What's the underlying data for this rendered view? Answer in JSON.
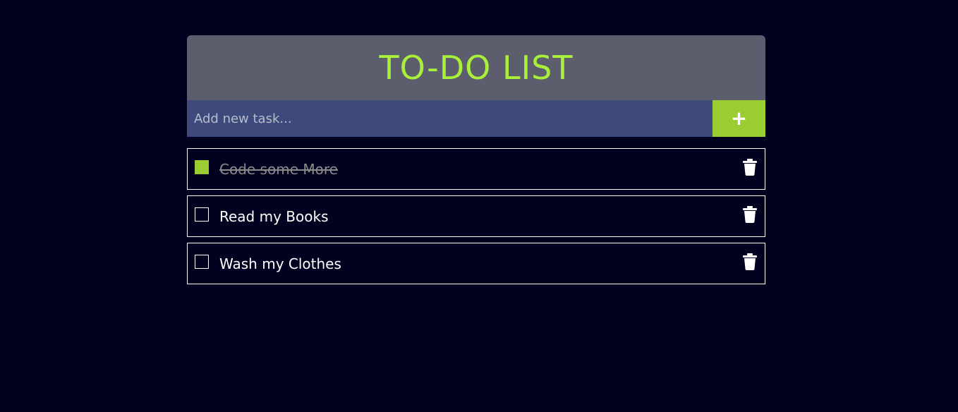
{
  "app": {
    "title": "TO-DO LIST"
  },
  "input": {
    "placeholder": "Add new task...",
    "value": "",
    "add_label": "+"
  },
  "tasks": [
    {
      "text": "Code some More",
      "done": true
    },
    {
      "text": "Read my Books",
      "done": false
    },
    {
      "text": "Wash my Clothes",
      "done": false
    }
  ],
  "colors": {
    "background": "#020220",
    "header": "#5c5e6d",
    "title": "#a9f03a",
    "input": "#3d4a7b",
    "accent": "#9acd32"
  },
  "icons": {
    "add": "plus-icon",
    "delete": "trash-icon",
    "check": "checkbox-icon"
  }
}
